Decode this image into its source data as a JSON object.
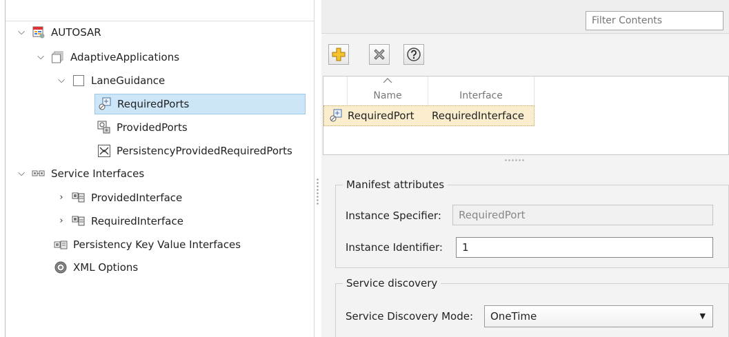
{
  "tree": {
    "root": {
      "label": "AUTOSAR"
    },
    "adaptive_applications": {
      "label": "AdaptiveApplications"
    },
    "lane_guidance": {
      "label": "LaneGuidance"
    },
    "required_ports": {
      "label": "RequiredPorts"
    },
    "provided_ports": {
      "label": "ProvidedPorts"
    },
    "persistency_ports": {
      "label": "PersistencyProvidedRequiredPorts"
    },
    "service_interfaces": {
      "label": "Service Interfaces"
    },
    "provided_interface": {
      "label": "ProvidedInterface"
    },
    "required_interface": {
      "label": "RequiredInterface"
    },
    "persistency_kv_interfaces": {
      "label": "Persistency Key Value Interfaces"
    },
    "xml_options": {
      "label": "XML Options"
    }
  },
  "filter": {
    "placeholder": "Filter Contents"
  },
  "toolbar": {
    "add_icon": "add-icon",
    "delete_icon": "delete-icon",
    "help_icon": "help-icon"
  },
  "table": {
    "columns": [
      "Name",
      "Interface"
    ],
    "rows": [
      {
        "name": "RequiredPort",
        "interface": "RequiredInterface"
      }
    ]
  },
  "manifest": {
    "legend": "Manifest attributes",
    "instance_specifier_label": "Instance Specifier:",
    "instance_specifier_value": "RequiredPort",
    "instance_identifier_label": "Instance Identifier:",
    "instance_identifier_value": "1"
  },
  "service_discovery": {
    "legend": "Service discovery",
    "mode_label": "Service Discovery Mode:",
    "mode_value": "OneTime"
  },
  "colors": {
    "selection": "#cde6f7",
    "row_highlight": "#fbeecf",
    "panel_bg": "#f3f3f3"
  }
}
